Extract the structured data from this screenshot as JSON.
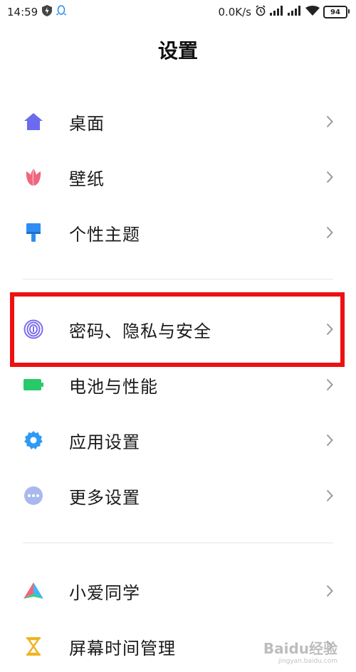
{
  "statusbar": {
    "time": "14:59",
    "net_speed": "0.0K/s",
    "battery": "94"
  },
  "page": {
    "title": "设置"
  },
  "items": [
    {
      "label": "桌面",
      "icon": "home-icon",
      "color": "#6b6bf0"
    },
    {
      "label": "壁纸",
      "icon": "tulip-icon",
      "color": "#f0667f"
    },
    {
      "label": "个性主题",
      "icon": "brush-icon",
      "color": "#2f8df2"
    },
    {
      "label": "密码、隐私与安全",
      "icon": "fingerprint-icon",
      "color": "#7b6cf0"
    },
    {
      "label": "电池与性能",
      "icon": "battery-icon",
      "color": "#27c96b"
    },
    {
      "label": "应用设置",
      "icon": "gear-icon",
      "color": "#2f9af4"
    },
    {
      "label": "更多设置",
      "icon": "more-icon",
      "color": "#a9b8ee"
    },
    {
      "label": "小爱同学",
      "icon": "xiaoai-icon",
      "color": "#3fb8f5"
    },
    {
      "label": "屏幕时间管理",
      "icon": "hourglass-icon",
      "color": "#f0b323"
    }
  ],
  "colors": {
    "highlight": "#ee1111",
    "chevron": "#9a9a9a"
  },
  "watermark": {
    "main": "Baidu经验",
    "sub": "jingyan.baidu.com"
  }
}
